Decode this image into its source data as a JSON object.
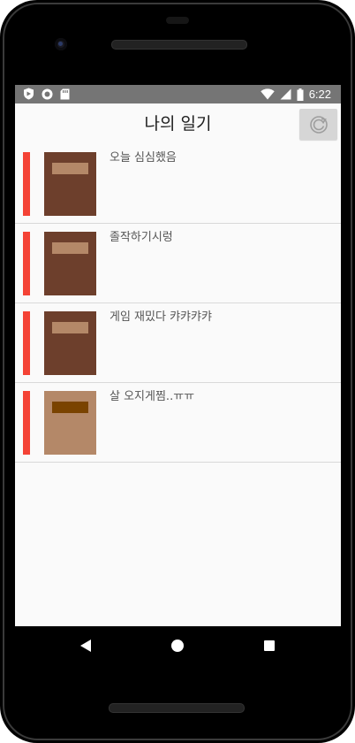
{
  "status_bar": {
    "time": "6:22",
    "icons": [
      "shield-icon",
      "circle-icon",
      "sd-card-icon",
      "wifi-icon",
      "signal-icon",
      "battery-icon"
    ]
  },
  "app_bar": {
    "title": "나의 일기",
    "refresh_icon": "refresh-icon"
  },
  "entries": [
    {
      "title": "오늘 심심했음",
      "mood_color": "#f44336",
      "cover_color": "#6d3f2c",
      "cover_label_color": "#b48868"
    },
    {
      "title": "졸작하기시렁",
      "mood_color": "#f44336",
      "cover_color": "#6d3f2c",
      "cover_label_color": "#b48868"
    },
    {
      "title": "게임 재밌다 캬캬캬캬",
      "mood_color": "#f44336",
      "cover_color": "#6d3f2c",
      "cover_label_color": "#b48868"
    },
    {
      "title": "살 오지게찜..ㅠㅠ",
      "mood_color": "#f44336",
      "cover_color": "#b48868",
      "cover_label_color": "#7a4300"
    }
  ],
  "nav_bar": {
    "buttons": [
      "back-icon",
      "home-icon",
      "recents-icon"
    ]
  },
  "colors": {
    "status_bar_bg": "#757575",
    "screen_bg": "#fafafa",
    "mood_red": "#f44336",
    "divider": "#d9d9d9"
  }
}
